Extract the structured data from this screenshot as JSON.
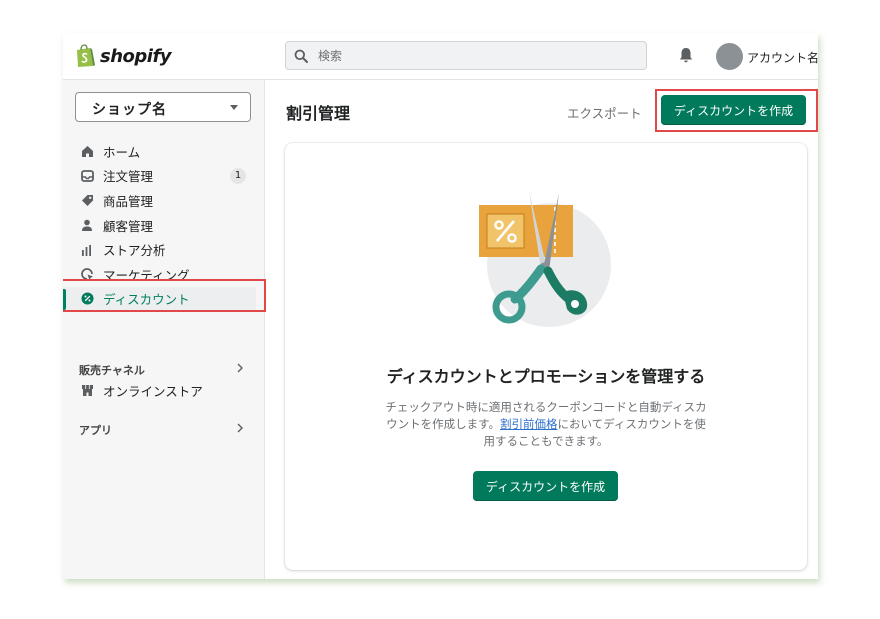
{
  "topbar": {
    "logo_text": "shopify",
    "search_placeholder": "検索",
    "account_name": "アカウント名"
  },
  "sidebar": {
    "shop_name": "ショップ名",
    "items": [
      {
        "label": "ホーム",
        "icon": "home-icon"
      },
      {
        "label": "注文管理",
        "icon": "orders-icon",
        "badge": "1"
      },
      {
        "label": "商品管理",
        "icon": "tag-icon"
      },
      {
        "label": "顧客管理",
        "icon": "person-icon"
      },
      {
        "label": "ストア分析",
        "icon": "analytics-icon"
      },
      {
        "label": "マーケティング",
        "icon": "marketing-icon"
      },
      {
        "label": "ディスカウント",
        "icon": "discount-icon",
        "active": true
      }
    ],
    "sales_channels_heading": "販売チャネル",
    "sales_channels": [
      {
        "label": "オンラインストア",
        "icon": "store-icon"
      }
    ],
    "apps_heading": "アプリ"
  },
  "main": {
    "title": "割引管理",
    "export_label": "エクスポート",
    "create_button_label": "ディスカウントを作成",
    "empty_state": {
      "heading": "ディスカウントとプロモーションを管理する",
      "body_before_link": "チェックアウト時に適用されるクーポンコードと自動ディスカウントを作成します。",
      "link_text": "割引前価格",
      "body_after_link": "においてディスカウントを使用することもできます。",
      "button_label": "ディスカウントを作成"
    }
  },
  "colors": {
    "primary": "#007a5a",
    "active_nav": "#008060",
    "highlight_outline": "#e2474a",
    "illustration_orange": "#e8a33d",
    "illustration_teal": "#3d9c8f"
  }
}
